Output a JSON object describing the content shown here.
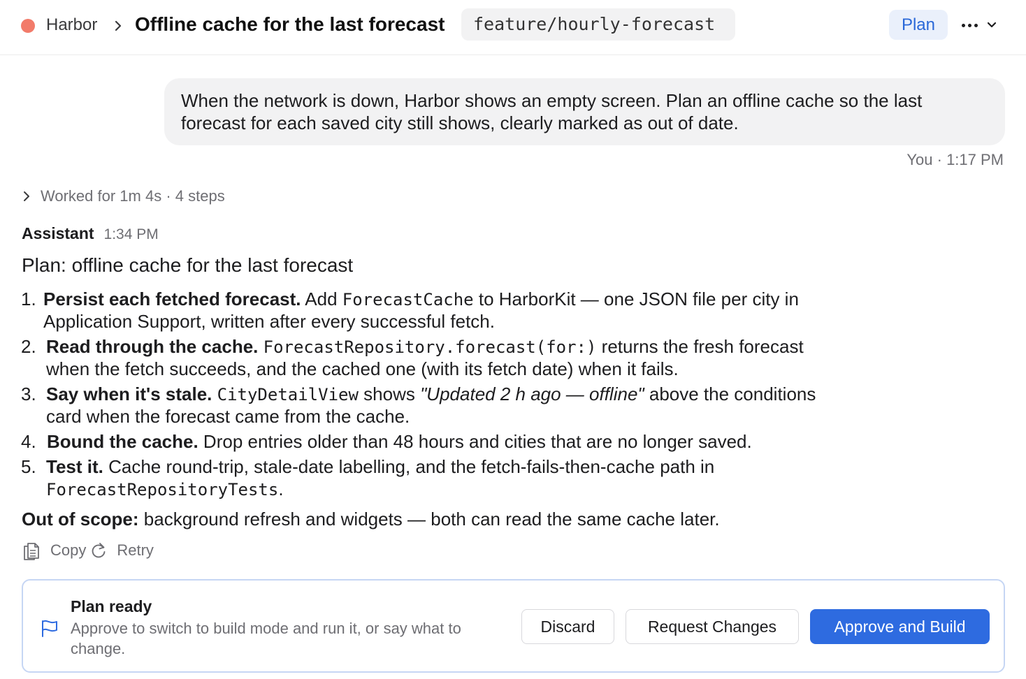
{
  "header": {
    "app_name": "Harbor",
    "title": "Offline cache for the last forecast",
    "branch": "feature/hourly-forecast",
    "mode_button": "Plan",
    "status_dot_color": "#f27b6a"
  },
  "user_message": {
    "text": "When the network is down, Harbor shows an empty screen. Plan an offline cache so the last forecast for each saved city still shows, clearly marked as out of date.",
    "meta": "You · 1:17 PM"
  },
  "worked": {
    "label": "Worked for 1m 4s · 4 steps"
  },
  "assistant": {
    "name": "Assistant",
    "time": "1:34 PM",
    "plan_title": "Plan: offline cache for the last forecast",
    "steps": [
      {
        "num": "1.",
        "bold": "Persist each fetched forecast.",
        "t1": " Add ",
        "code1": "ForecastCache",
        "t2": " to HarborKit — one JSON file per city in",
        "line2": "Application Support, written after every successful fetch."
      },
      {
        "num": "2.",
        "bold": "Read through the cache.",
        "t1": " ",
        "code1": "ForecastRepository.forecast(for:)",
        "t2": " returns the fresh forecast",
        "line2": "when the fetch succeeds, and the cached one (with its fetch date) when it fails."
      },
      {
        "num": "3.",
        "bold": "Say when it's stale.",
        "t1": " ",
        "code1": "CityDetailView",
        "t2": " shows ",
        "quote": "\"Updated 2 h ago — offline\"",
        "t3": " above the conditions",
        "line2": "card when the forecast came from the cache."
      },
      {
        "num": "4.",
        "bold": "Bound the cache.",
        "t1": " Drop entries older than 48 hours and cities that are no longer saved."
      },
      {
        "num": "5.",
        "bold": "Test it.",
        "t1": " Cache round-trip, stale-date labelling, and the fetch-fails-then-cache path in",
        "code2": "ForecastRepositoryTests",
        "t2": "."
      }
    ],
    "scope_bold": "Out of scope:",
    "scope_text": " background refresh and widgets — both can read the same cache later.",
    "copy_label": "Copy",
    "retry_label": "Retry"
  },
  "plan_card": {
    "title": "Plan ready",
    "subtitle": "Approve to switch to build mode and run it, or say what to change.",
    "discard": "Discard",
    "request_changes": "Request Changes",
    "approve": "Approve and Build",
    "accent_color": "#2e6be0"
  }
}
